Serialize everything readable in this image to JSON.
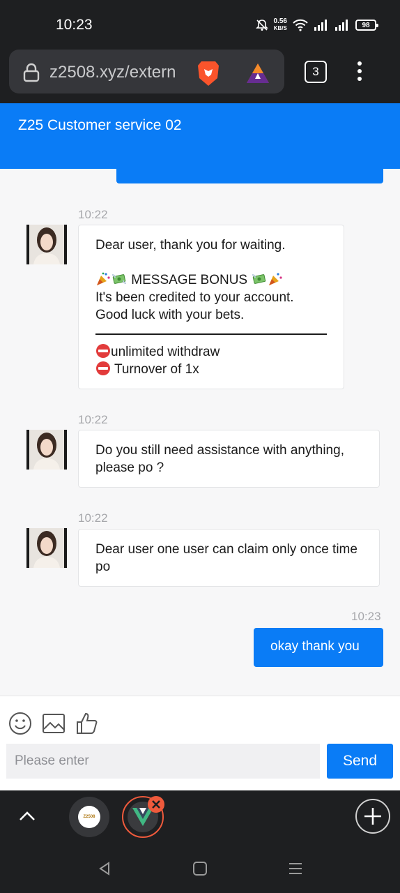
{
  "status": {
    "time": "10:23",
    "net_speed_value": "0.56",
    "net_speed_unit": "KB/S",
    "battery": "98"
  },
  "browser": {
    "url": "z2508.xyz/extern",
    "tab_count": "3"
  },
  "chat": {
    "title": "Z25 Customer service 02",
    "messages": [
      {
        "time": "10:22",
        "line1": "Dear user, thank you for waiting.",
        "bonus": "MESSAGE BONUS",
        "line2": "It's been credited to your account.",
        "line3": "Good luck with your bets.",
        "item1": "unlimited withdraw",
        "item2": "Turnover of 1x"
      },
      {
        "time": "10:22",
        "text": "Do you still need assistance with anything, please po ?"
      },
      {
        "time": "10:22",
        "text": "Dear user one user can claim only once time po"
      },
      {
        "time": "10:23",
        "text": "okay thank you"
      }
    ]
  },
  "input": {
    "placeholder": "Please enter",
    "send_label": "Send"
  },
  "tab_bubble_label": "Z2508",
  "colors": {
    "accent": "#0a7cf6",
    "dark_bar": "#1e1f21",
    "close_badge": "#ef5a3c"
  }
}
